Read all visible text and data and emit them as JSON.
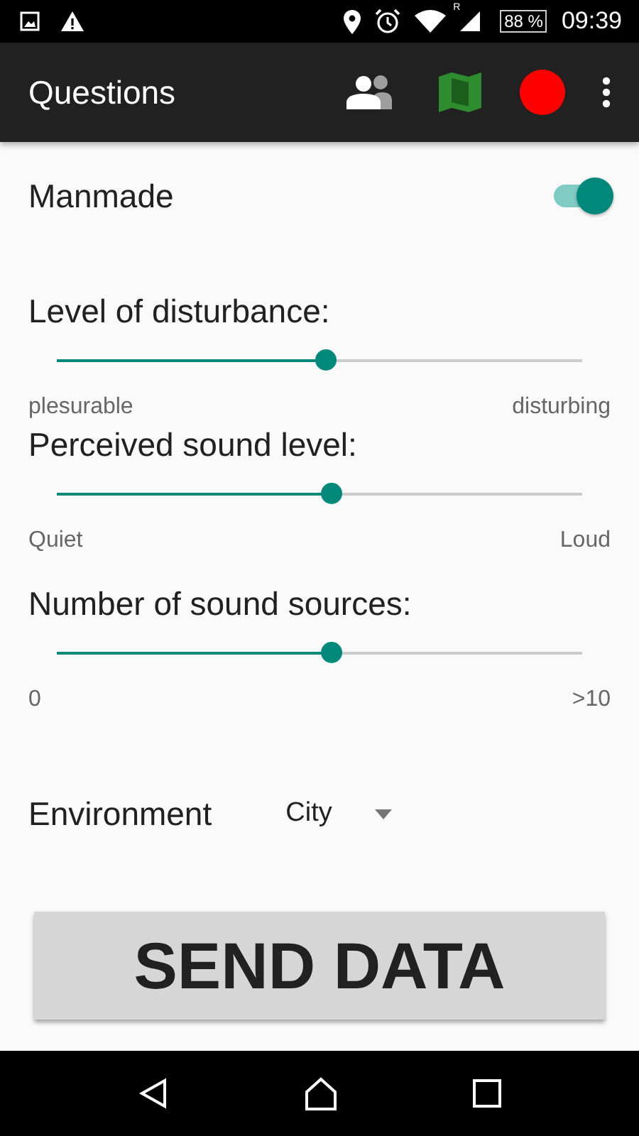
{
  "status_bar": {
    "roaming_mark": "R",
    "battery": "88 %",
    "time": "09:39"
  },
  "toolbar": {
    "title": "Questions"
  },
  "manmade": {
    "label": "Manmade",
    "on": true
  },
  "sliders": [
    {
      "label": "Level of disturbance:",
      "level": 0.49,
      "min_label": "plesurable",
      "max_label": "disturbing"
    },
    {
      "label": "Perceived sound level:",
      "level": 0.5,
      "min_label": "Quiet",
      "max_label": "Loud"
    },
    {
      "label": "Number of sound sources:",
      "level": 0.5,
      "min_label": "0",
      "max_label": ">10"
    }
  ],
  "environment": {
    "label": "Environment",
    "value": "City"
  },
  "send_button": "SEND DATA"
}
